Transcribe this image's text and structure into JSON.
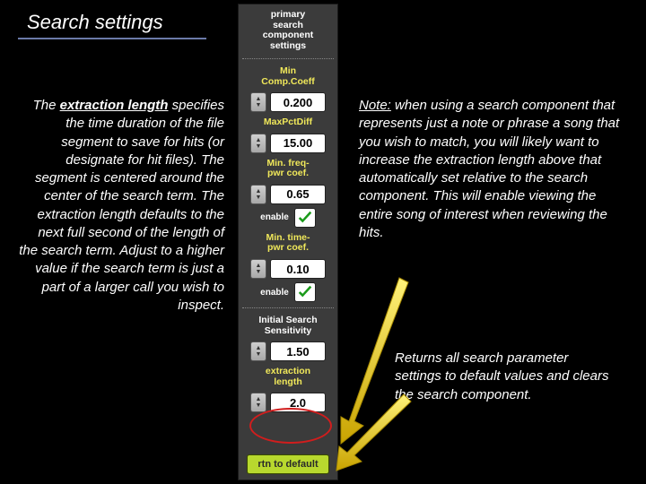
{
  "title": "Search settings",
  "left_text": {
    "bold": "extraction length",
    "before": "The ",
    "after": " specifies the time duration of the file segment to save for hits (or designate for hit files). The segment is centered around the center of the search term. The extraction length defaults to the next full second of the length of the search term. Adjust to a higher value if the search term is just a part of a larger call you wish to inspect."
  },
  "right_note": {
    "note_label": "Note:",
    "body": " when using a search component that represents just a note or phrase a song that you wish to match, you will likely want to increase the extraction length above that automatically set relative to the search component. This will enable viewing the entire song of interest when reviewing the hits."
  },
  "right_return": "Returns all search parameter settings to default values and clears the search component.",
  "panel": {
    "header_l1": "primary",
    "header_l2": "search",
    "header_l3": "component",
    "header_l4": "settings",
    "min_comp_label_l1": "Min",
    "min_comp_label_l2": "Comp.Coeff",
    "min_comp_value": "0.200",
    "max_pct_label": "MaxPctDiff",
    "max_pct_value": "15.00",
    "min_freq_label_l1": "Min. freq-",
    "min_freq_label_l2": "pwr coef.",
    "min_freq_value": "0.65",
    "enable1_label": "enable",
    "min_time_label_l1": "Min. time-",
    "min_time_label_l2": "pwr coef.",
    "min_time_value": "0.10",
    "enable2_label": "enable",
    "initial_label_l1": "Initial Search",
    "initial_label_l2": "Sensitivity",
    "initial_value": "1.50",
    "extraction_label_l1": "extraction",
    "extraction_label_l2": "length",
    "extraction_value": "2.0",
    "return_button": "rtn to default"
  }
}
